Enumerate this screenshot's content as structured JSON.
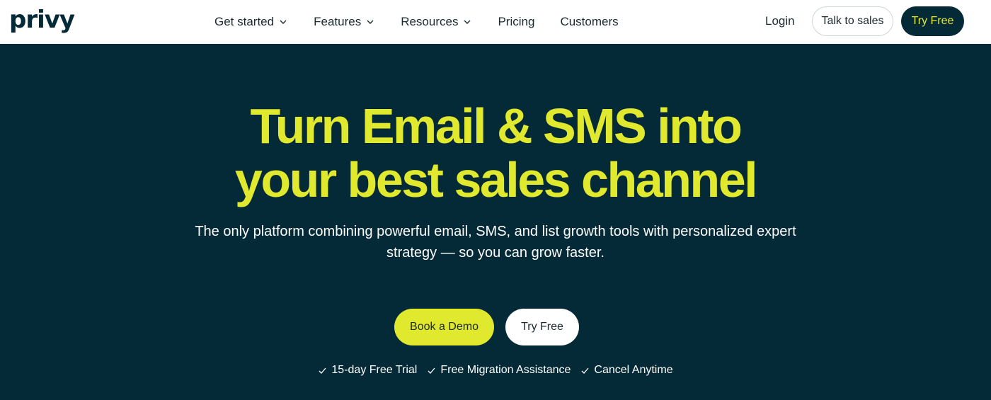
{
  "header": {
    "logo": "privy",
    "nav": [
      {
        "label": "Get started",
        "dropdown": true,
        "icon": "chevron-down-icon"
      },
      {
        "label": "Features",
        "dropdown": true,
        "icon": "chevron-down-icon"
      },
      {
        "label": "Resources",
        "dropdown": true,
        "icon": "chevron-down-icon"
      },
      {
        "label": "Pricing",
        "dropdown": false
      },
      {
        "label": "Customers",
        "dropdown": false
      }
    ],
    "login_label": "Login",
    "talk_to_sales_label": "Talk to sales",
    "try_free_label": "Try Free"
  },
  "hero": {
    "headline_line1": "Turn Email & SMS into",
    "headline_line2": "your best sales channel",
    "subtext_line1": "The only platform combining powerful email, SMS, and list growth tools with personalized expert",
    "subtext_line2": "strategy — so you can grow faster.",
    "book_demo_label": "Book a Demo",
    "try_free_label": "Try Free",
    "perks": [
      {
        "label": "15-day Free Trial",
        "icon": "check-icon"
      },
      {
        "label": "Free Migration Assistance",
        "icon": "check-icon"
      },
      {
        "label": "Cancel Anytime",
        "icon": "check-icon"
      }
    ]
  },
  "colors": {
    "brand_dark": "#052a37",
    "accent_yellow": "#e1e92f",
    "white": "#ffffff"
  }
}
